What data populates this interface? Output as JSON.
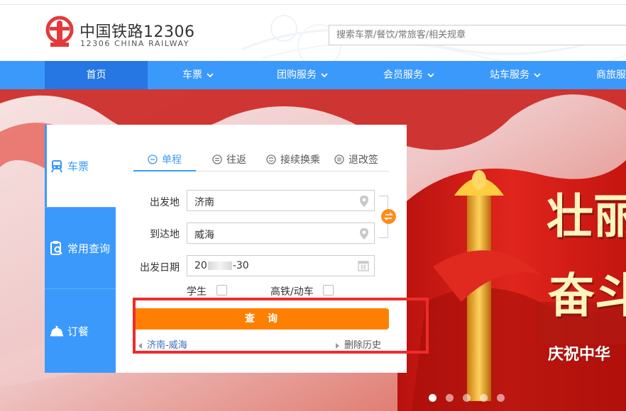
{
  "header": {
    "logo_cn": "中国铁路12306",
    "logo_en": "12306 CHINA RAILWAY",
    "search_placeholder": "搜索车票/餐饮/常旅客/相关规章"
  },
  "nav": {
    "items": [
      {
        "label": "首页",
        "active": true
      },
      {
        "label": "车票"
      },
      {
        "label": "团购服务"
      },
      {
        "label": "会员服务"
      },
      {
        "label": "站车服务"
      },
      {
        "label": "商旅服"
      }
    ]
  },
  "sidebar": {
    "items": [
      {
        "label": "车票",
        "icon": "train-icon"
      },
      {
        "label": "常用查询",
        "icon": "clipboard-search-icon"
      },
      {
        "label": "订餐",
        "icon": "food-bell-icon"
      }
    ]
  },
  "booking": {
    "trip_tabs": [
      {
        "label": "单程",
        "icon": "arrow-circle-icon"
      },
      {
        "label": "往返",
        "icon": "equals-circle-icon"
      },
      {
        "label": "接续换乘",
        "icon": "transfer-circle-icon"
      },
      {
        "label": "退改签",
        "icon": "list-circle-icon"
      }
    ],
    "from_label": "出发地",
    "from_value": "济南",
    "to_label": "到达地",
    "to_value": "威海",
    "date_label": "出发日期",
    "date_value_prefix": "20",
    "date_value_suffix": "-30",
    "student_label": "学生",
    "high_speed_label": "高铁/动车",
    "search_label": "查询",
    "history_item": "济南-威海",
    "clear_history": "删除历史"
  },
  "banner": {
    "slogan_line1": "壮丽",
    "slogan_line2": "奋斗",
    "slogan_line3": "庆祝中华",
    "dots_total": 5,
    "dots_active": 0
  },
  "colors": {
    "brand_blue": "#3b99fc",
    "nav_active": "#2676e3",
    "orange": "#ff8000",
    "logo_red": "#e4393c",
    "highlight_red": "#ee2c2c"
  }
}
